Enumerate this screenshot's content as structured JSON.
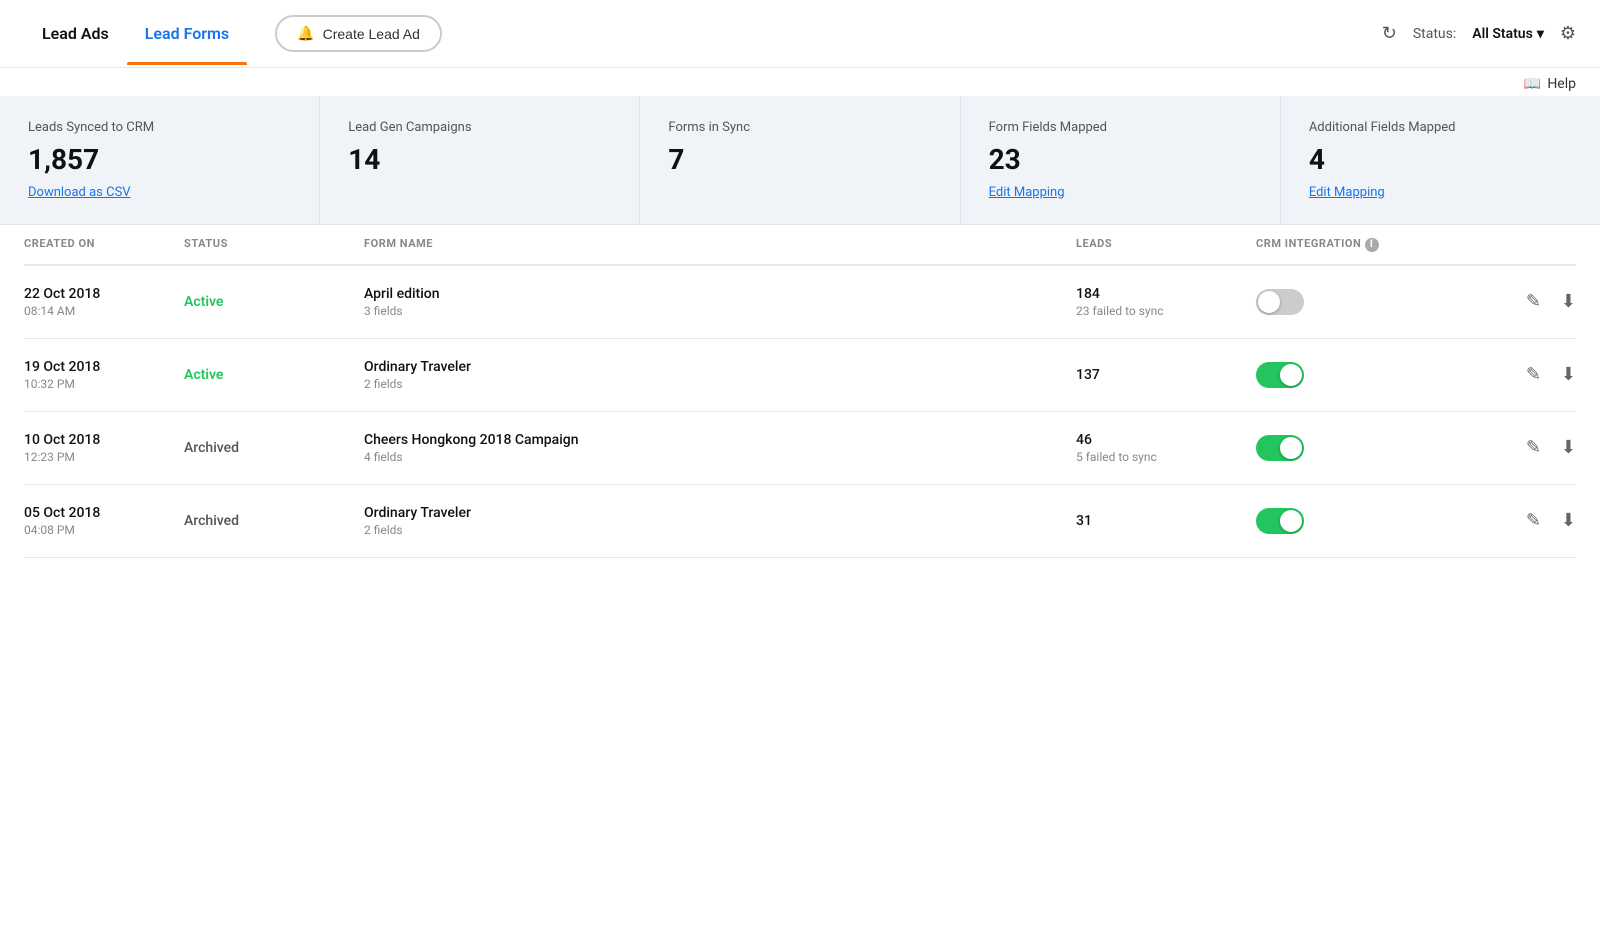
{
  "nav": {
    "tab_lead_ads": "Lead Ads",
    "tab_lead_forms": "Lead Forms",
    "create_btn": "Create Lead Ad",
    "create_icon": "🔔",
    "status_label": "Status:",
    "status_value": "All Status",
    "help_label": "Help"
  },
  "stats": [
    {
      "title": "Leads Synced to CRM",
      "value": "1,857",
      "link": "Download as CSV"
    },
    {
      "title": "Lead Gen Campaigns",
      "value": "14",
      "link": null
    },
    {
      "title": "Forms in Sync",
      "value": "7",
      "link": null
    },
    {
      "title": "Form Fields Mapped",
      "value": "23",
      "link": "Edit Mapping"
    },
    {
      "title": "Additional Fields Mapped",
      "value": "4",
      "link": "Edit Mapping"
    }
  ],
  "table": {
    "columns": [
      "CREATED ON",
      "STATUS",
      "FORM NAME",
      "LEADS",
      "CRM INTEGRATION",
      ""
    ],
    "rows": [
      {
        "date": "22 Oct 2018",
        "time": "08:14 AM",
        "status": "Active",
        "status_type": "active",
        "form_name": "April edition",
        "fields": "3 fields",
        "leads": "184",
        "failed": "23 failed to sync",
        "crm_on": false
      },
      {
        "date": "19 Oct 2018",
        "time": "10:32 PM",
        "status": "Active",
        "status_type": "active",
        "form_name": "Ordinary Traveler",
        "fields": "2 fields",
        "leads": "137",
        "failed": null,
        "crm_on": true
      },
      {
        "date": "10 Oct 2018",
        "time": "12:23 PM",
        "status": "Archived",
        "status_type": "archived",
        "form_name": "Cheers Hongkong 2018 Campaign",
        "fields": "4 fields",
        "leads": "46",
        "failed": "5 failed to sync",
        "crm_on": true
      },
      {
        "date": "05 Oct 2018",
        "time": "04:08 PM",
        "status": "Archived",
        "status_type": "archived",
        "form_name": "Ordinary Traveler",
        "fields": "2 fields",
        "leads": "31",
        "failed": null,
        "crm_on": true
      }
    ]
  }
}
